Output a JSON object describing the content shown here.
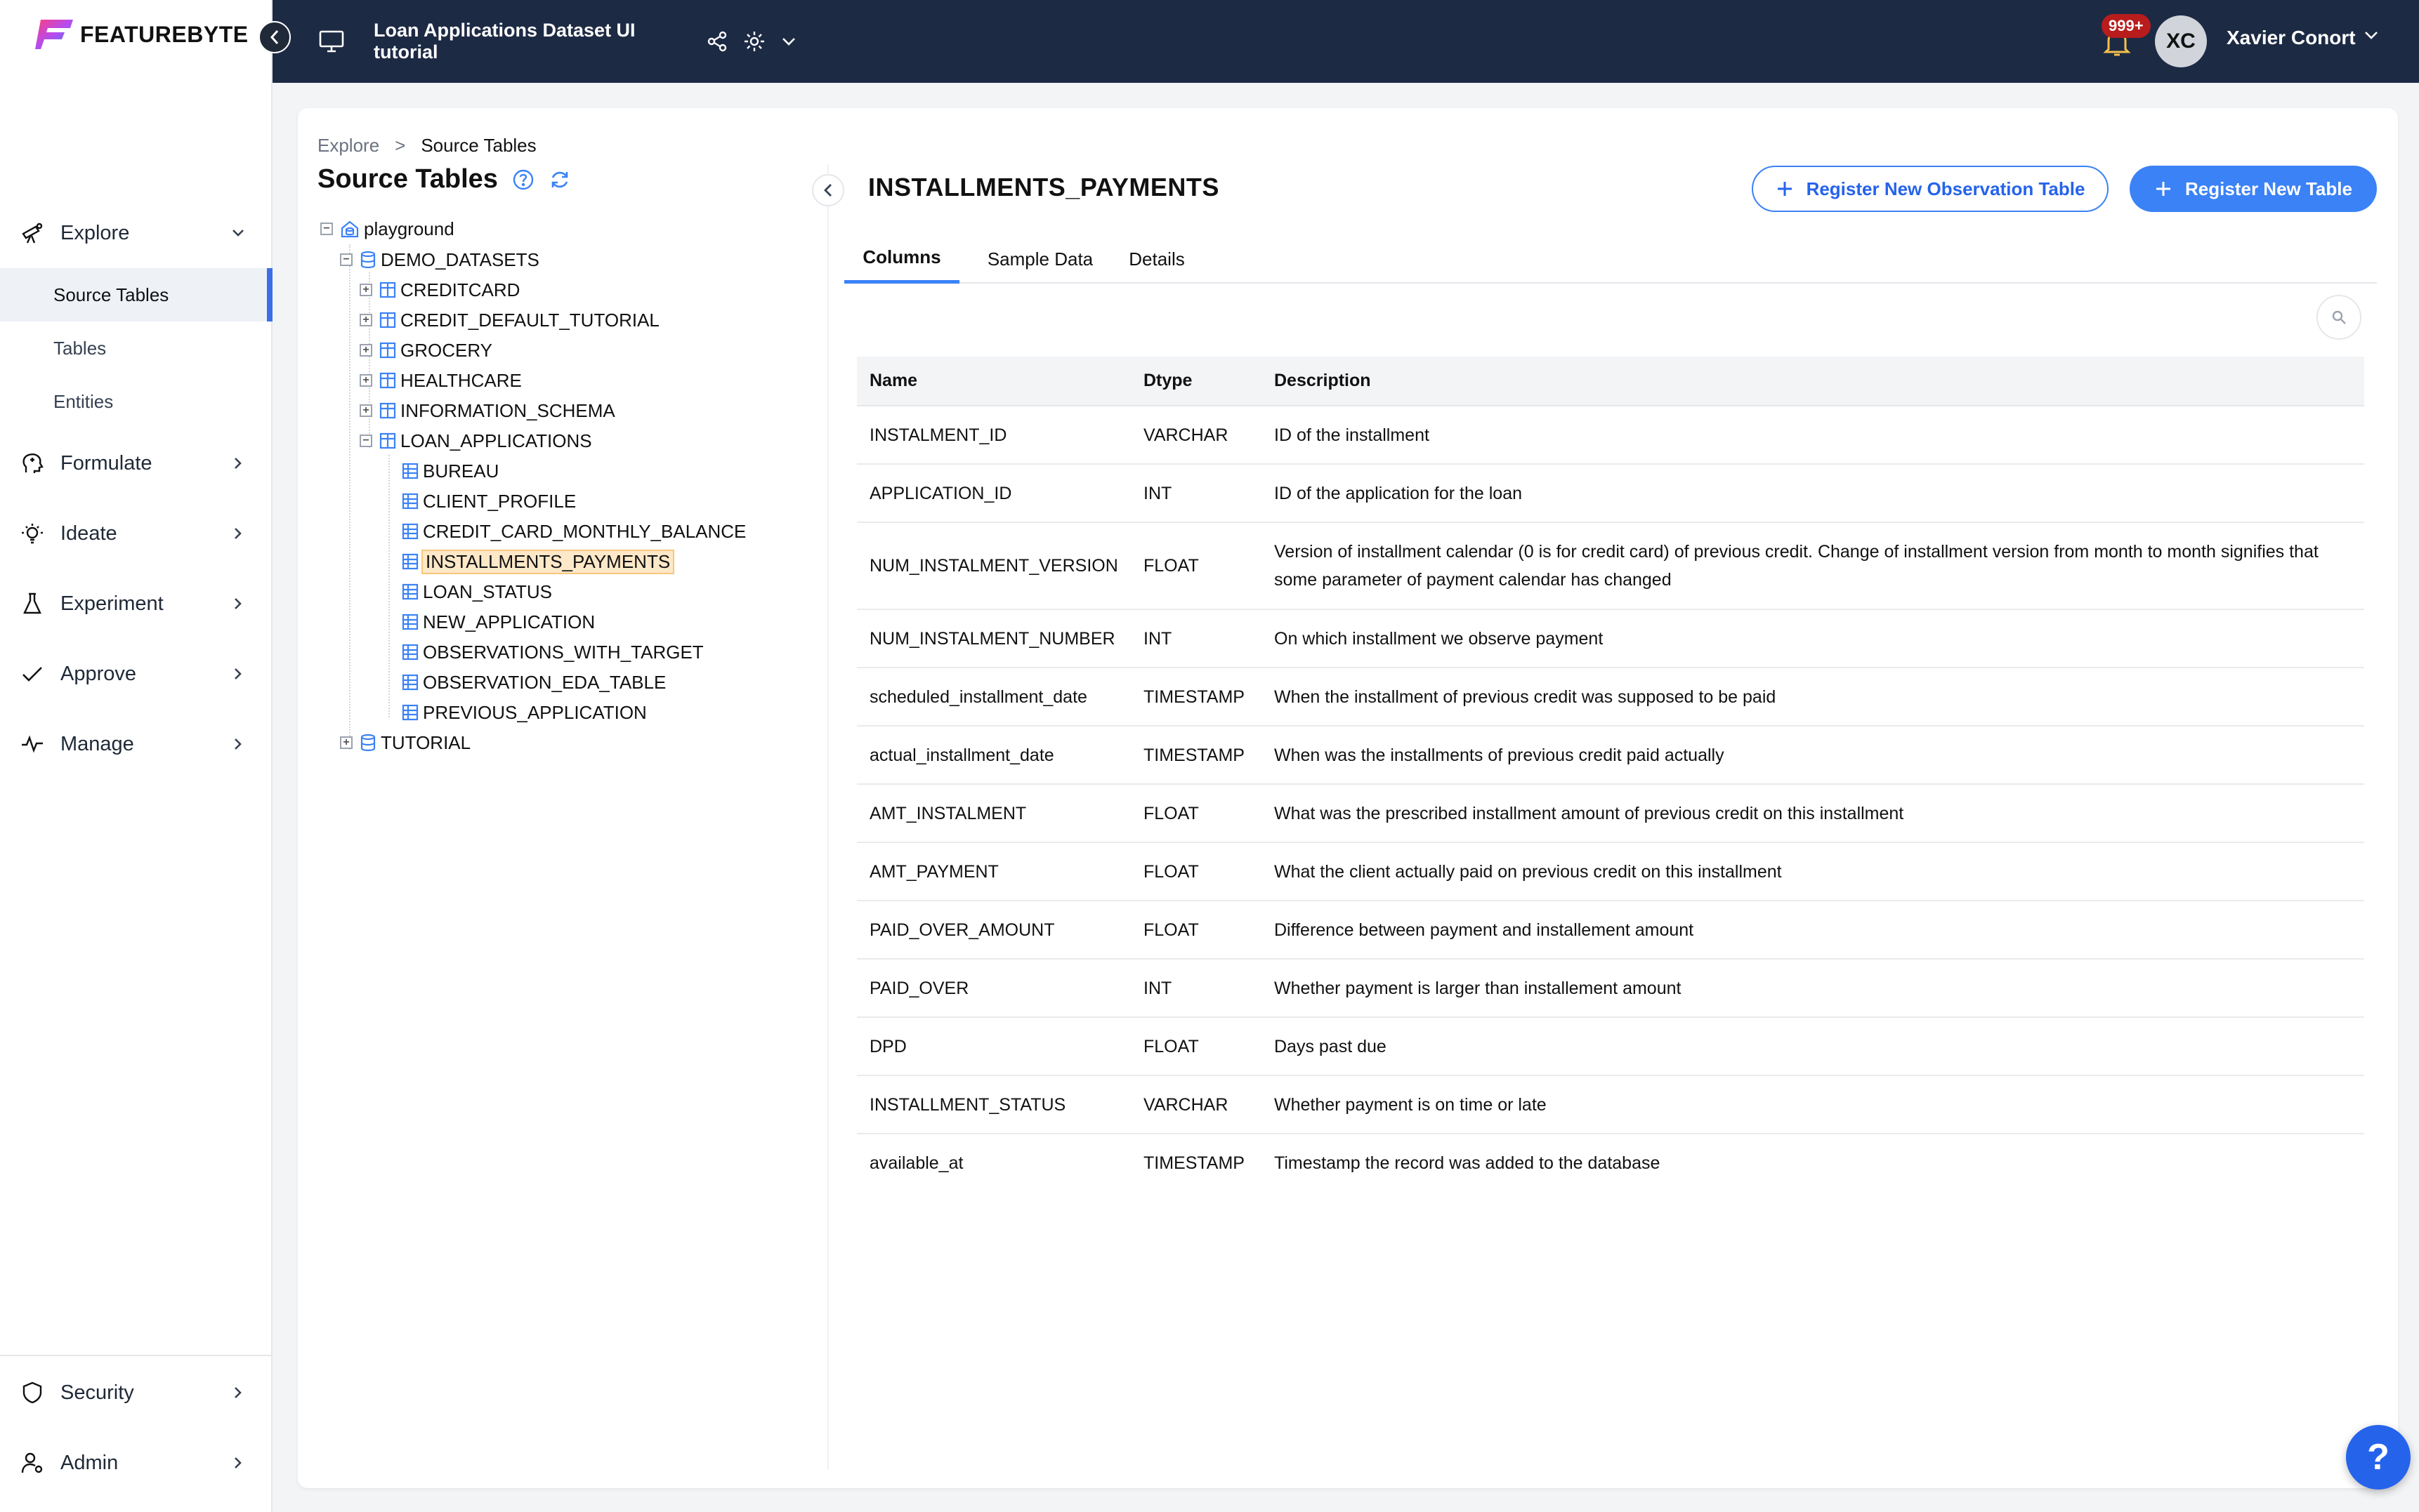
{
  "brand": {
    "name": "FEATUREBYTE"
  },
  "project": {
    "title": "Loan Applications Dataset UI tutorial"
  },
  "user": {
    "name": "Xavier Conort",
    "initials": "XC",
    "notifications": "999+"
  },
  "sidebar": {
    "items": [
      {
        "label": "Explore",
        "icon": "explore-icon"
      },
      {
        "label": "Formulate",
        "icon": "formulate-icon"
      },
      {
        "label": "Ideate",
        "icon": "ideate-icon"
      },
      {
        "label": "Experiment",
        "icon": "experiment-icon"
      },
      {
        "label": "Approve",
        "icon": "approve-icon"
      },
      {
        "label": "Manage",
        "icon": "manage-icon"
      }
    ],
    "explore_sub": [
      "Source Tables",
      "Tables",
      "Entities"
    ],
    "bottom": [
      {
        "label": "Security",
        "icon": "shield-icon"
      },
      {
        "label": "Admin",
        "icon": "admin-icon"
      }
    ]
  },
  "breadcrumb": {
    "root": "Explore",
    "separator": ">",
    "current": "Source Tables"
  },
  "panel": {
    "title": "Source Tables"
  },
  "tree": {
    "root": "playground",
    "database": "DEMO_DATASETS",
    "schemas": [
      "CREDITCARD",
      "CREDIT_DEFAULT_TUTORIAL",
      "GROCERY",
      "HEALTHCARE",
      "INFORMATION_SCHEMA",
      "LOAN_APPLICATIONS"
    ],
    "tables": [
      "BUREAU",
      "CLIENT_PROFILE",
      "CREDIT_CARD_MONTHLY_BALANCE",
      "INSTALLMENTS_PAYMENTS",
      "LOAN_STATUS",
      "NEW_APPLICATION",
      "OBSERVATIONS_WITH_TARGET",
      "OBSERVATION_EDA_TABLE",
      "PREVIOUS_APPLICATION"
    ],
    "other_database": "TUTORIAL"
  },
  "detail": {
    "title": "INSTALLMENTS_PAYMENTS",
    "register_observation_label": "Register New Observation Table",
    "register_table_label": "Register New Table",
    "tabs": [
      "Columns",
      "Sample Data",
      "Details"
    ],
    "active_tab": "Columns"
  },
  "columns_table": {
    "headers": [
      "Name",
      "Dtype",
      "Description"
    ],
    "rows": [
      [
        "INSTALMENT_ID",
        "VARCHAR",
        "ID of the installment"
      ],
      [
        "APPLICATION_ID",
        "INT",
        "ID of the application for the loan"
      ],
      [
        "NUM_INSTALMENT_VERSION",
        "FLOAT",
        "Version of installment calendar (0 is for credit card) of previous credit. Change of installment version from month to month signifies that some parameter of payment calendar has changed"
      ],
      [
        "NUM_INSTALMENT_NUMBER",
        "INT",
        "On which installment we observe payment"
      ],
      [
        "scheduled_installment_date",
        "TIMESTAMP",
        "When the installment of previous credit was supposed to be paid"
      ],
      [
        "actual_installment_date",
        "TIMESTAMP",
        "When was the installments of previous credit paid actually"
      ],
      [
        "AMT_INSTALMENT",
        "FLOAT",
        "What was the prescribed installment amount of previous credit on this installment"
      ],
      [
        "AMT_PAYMENT",
        "FLOAT",
        "What the client actually paid on previous credit on this installment"
      ],
      [
        "PAID_OVER_AMOUNT",
        "FLOAT",
        "Difference between payment and installement amount"
      ],
      [
        "PAID_OVER",
        "INT",
        "Whether payment is larger than installement amount"
      ],
      [
        "DPD",
        "FLOAT",
        "Days past due"
      ],
      [
        "INSTALLMENT_STATUS",
        "VARCHAR",
        "Whether payment is on time or late"
      ],
      [
        "available_at",
        "TIMESTAMP",
        "Timestamp the record was added to the database"
      ]
    ]
  },
  "help": {
    "label": "?"
  },
  "colors": {
    "accent": "#3b82f6",
    "navbar": "#1d2a44",
    "badge": "#b91c1c"
  }
}
